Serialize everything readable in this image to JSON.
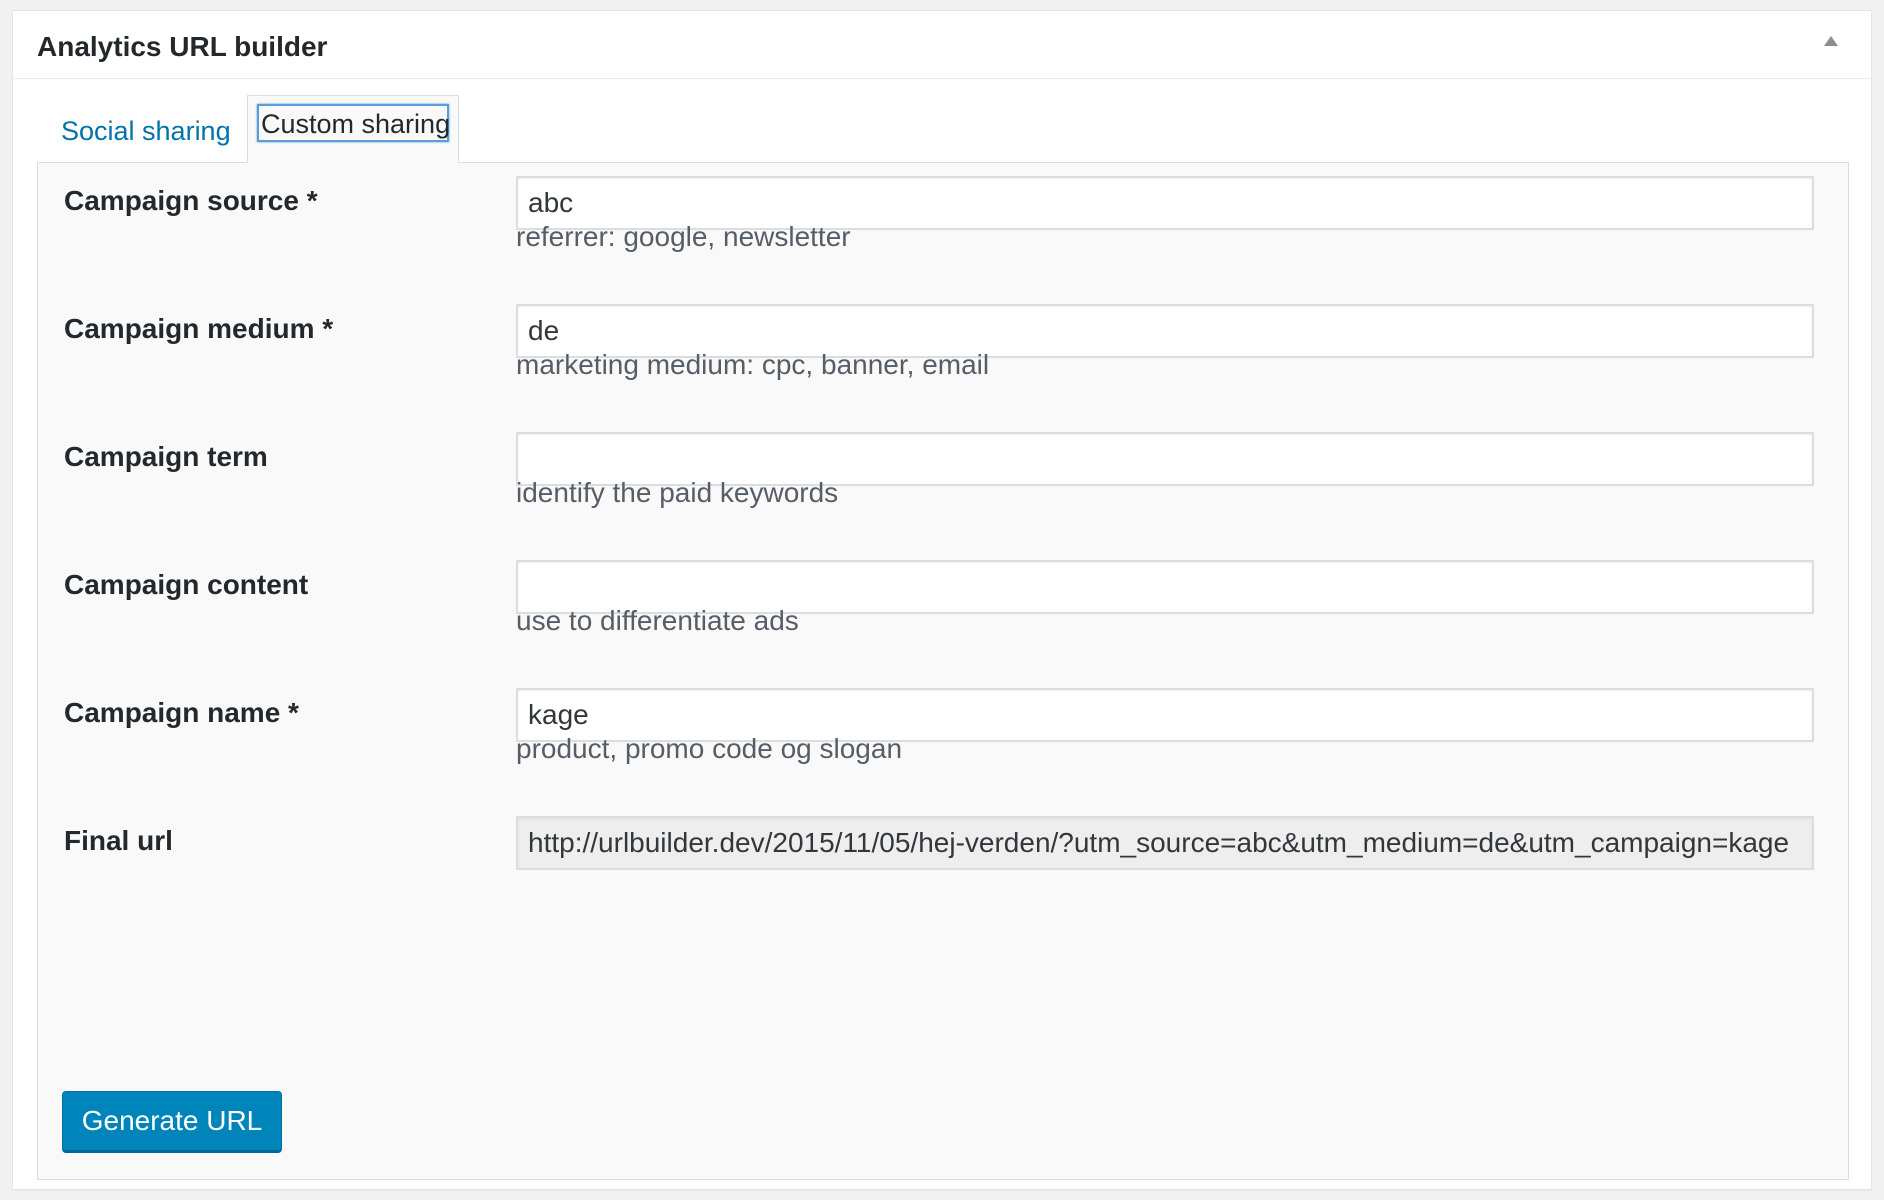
{
  "metabox": {
    "title": "Analytics URL builder"
  },
  "tabs": [
    {
      "label": "Social sharing",
      "active": false
    },
    {
      "label": "Custom sharing",
      "active": true
    }
  ],
  "fields": {
    "source": {
      "label": "Campaign source *",
      "value": "abc",
      "description": "referrer: google, newsletter"
    },
    "medium": {
      "label": "Campaign medium *",
      "value": "de",
      "description": "marketing medium: cpc, banner, email"
    },
    "term": {
      "label": "Campaign term",
      "value": "",
      "description": "identify the paid keywords"
    },
    "content": {
      "label": "Campaign content",
      "value": "",
      "description": "use to differentiate ads"
    },
    "name": {
      "label": "Campaign name *",
      "value": "kage",
      "description": "product, promo code og slogan"
    },
    "final_url": {
      "label": "Final url",
      "value": "http://urlbuilder.dev/2015/11/05/hej-verden/?utm_source=abc&utm_medium=de&utm_campaign=kage"
    }
  },
  "actions": {
    "generate_label": "Generate URL"
  },
  "icons": {
    "toggle": "triangle-up-icon"
  },
  "colors": {
    "link": "#0073aa",
    "primary_button": "#0085ba",
    "panel_bg": "#f9f9f9",
    "focus_ring": "#5b9dd9"
  }
}
